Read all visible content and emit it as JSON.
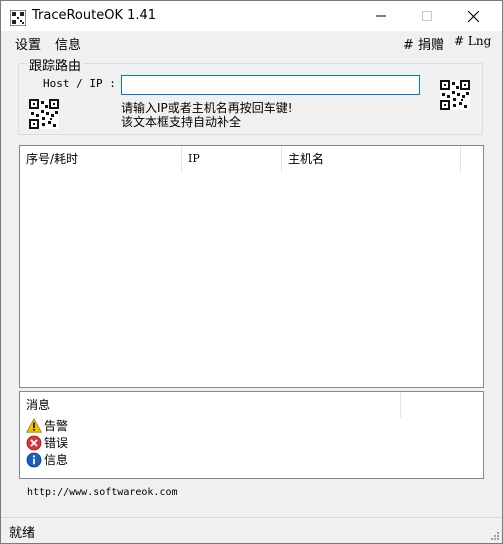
{
  "window": {
    "title": "TraceRouteOK 1.41",
    "icon": "qr-grid-icon",
    "controls": {
      "minimize": "—",
      "maximize": "☐",
      "close": "✕"
    }
  },
  "menu": {
    "settings": "设置",
    "info": "信息",
    "donate": "# 捐赠",
    "lng": "# Lng"
  },
  "trace": {
    "group_title": "跟踪路由",
    "host_label": "Host / IP :",
    "host_value": "",
    "host_placeholder": "",
    "hint_line1": "请输入IP或者主机名再按回车键!",
    "hint_line2": "该文本框支持自动补全"
  },
  "results": {
    "columns": [
      "序号/耗时",
      "IP",
      "主机名"
    ],
    "rows": []
  },
  "messages": {
    "header": "消息",
    "legend": [
      {
        "label": "告警",
        "icon": "warning-icon"
      },
      {
        "label": "错误",
        "icon": "error-icon"
      },
      {
        "label": "信息",
        "icon": "info-icon"
      }
    ]
  },
  "footer": {
    "url": "http://www.softwareok.com",
    "status": "就绪"
  },
  "colors": {
    "accent_border": "#0078d7",
    "window_bg": "#f0f0f0",
    "warning": "#f5c400",
    "error": "#d9363e",
    "info": "#1b5fbf"
  }
}
